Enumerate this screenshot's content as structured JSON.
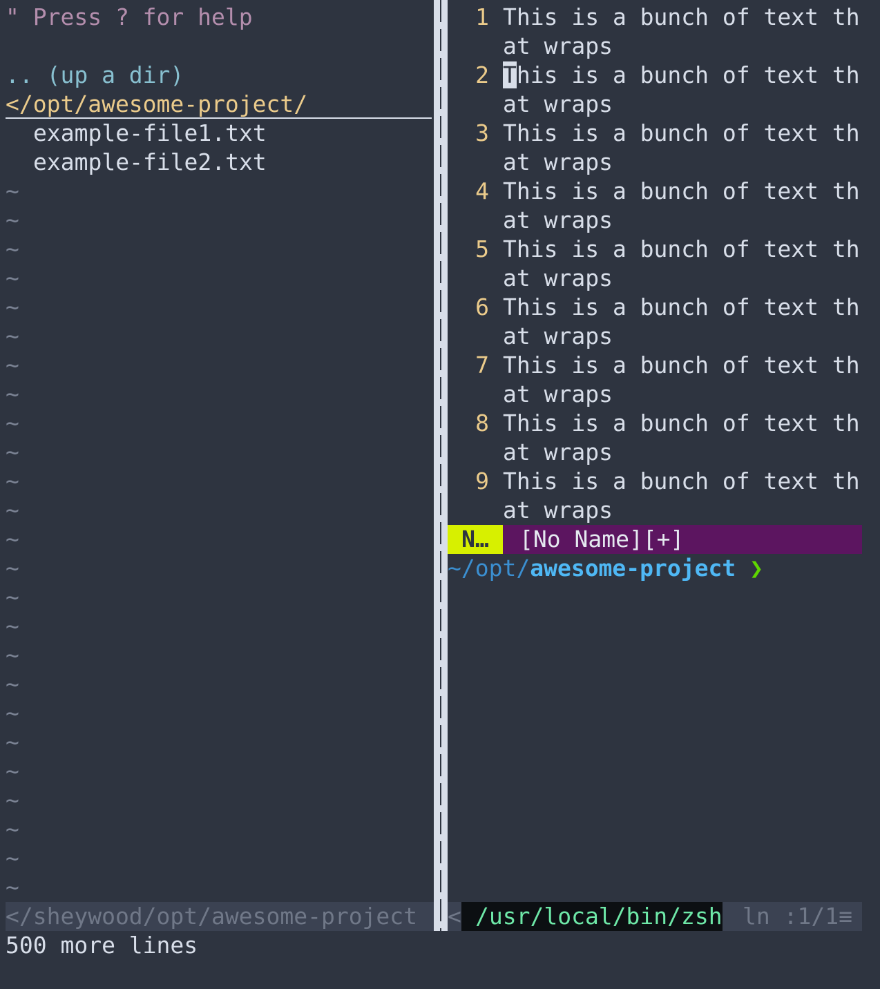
{
  "tree": {
    "help": "\" Press ? for help",
    "up_dir": ".. (up a dir)",
    "cwd": "</opt/awesome-project/",
    "files": [
      "example-file1.txt",
      "example-file2.txt"
    ],
    "tilde": "~"
  },
  "editor": {
    "line_text_1": "This is a bunch of text th",
    "line_text_2": "at wraps",
    "lines": [
      "1",
      "2",
      "3",
      "4",
      "5",
      "6",
      "7",
      "8",
      "9"
    ],
    "cursor_char": "T",
    "cursor_rest": "his is a bunch of text th"
  },
  "statusline": {
    "mode": "N…",
    "buffer": "[No Name][+]"
  },
  "prompt": {
    "tilde": "~",
    "dim": "/opt/",
    "dir": "awesome-project",
    "arrow": " ❯"
  },
  "bottom": {
    "left_path": "</sheywood/opt/awesome-project",
    "right_lt": "<",
    "shell": "/usr/local/bin/zsh",
    "position": "ln :1/1≡",
    "message": "500 more lines"
  },
  "colors": {
    "background": "#2e3440",
    "mode_bg": "#d7f000",
    "buffer_bg": "#5c1560"
  }
}
